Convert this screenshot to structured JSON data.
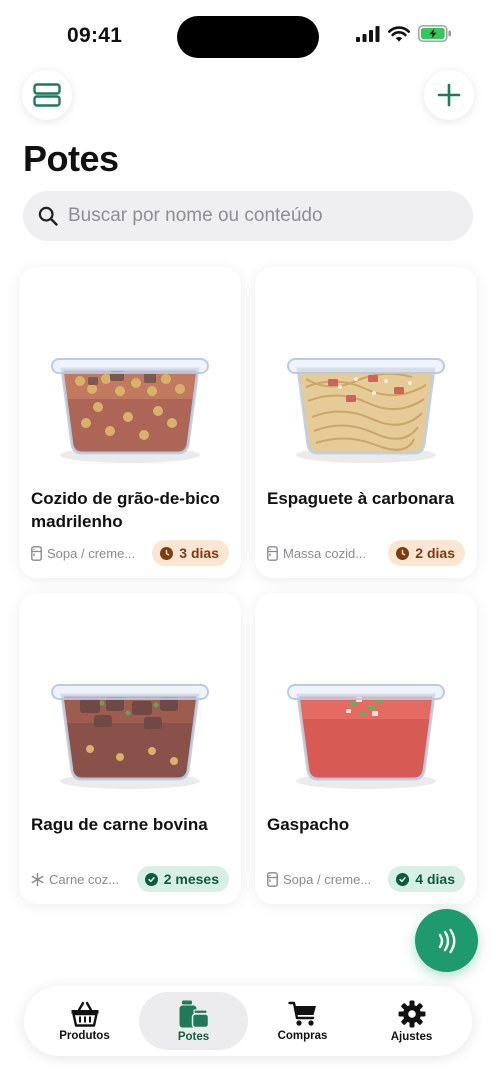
{
  "status_bar": {
    "time": "09:41"
  },
  "header": {
    "title": "Potes"
  },
  "search": {
    "placeholder": "Buscar por nome ou conteúdo"
  },
  "cards": [
    {
      "name": "Cozido de grão-de-bico madrilenho",
      "category": "Sopa / creme...",
      "category_icon": "fridge-icon",
      "badge": "3 dias",
      "badge_status": "warn"
    },
    {
      "name": "Espaguete à carbonara",
      "category": "Massa cozid...",
      "category_icon": "fridge-icon",
      "badge": "2 dias",
      "badge_status": "warn"
    },
    {
      "name": "Ragu de carne bovina",
      "category": "Carne coz...",
      "category_icon": "snowflake-icon",
      "badge": "2 meses",
      "badge_status": "ok"
    },
    {
      "name": "Gaspacho",
      "category": "Sopa / creme...",
      "category_icon": "fridge-icon",
      "badge": "4 dias",
      "badge_status": "ok"
    }
  ],
  "tabs": [
    {
      "label": "Produtos",
      "icon": "basket-icon"
    },
    {
      "label": "Potes",
      "icon": "jars-icon",
      "active": true
    },
    {
      "label": "Compras",
      "icon": "cart-icon"
    },
    {
      "label": "Ajustes",
      "icon": "gear-icon"
    }
  ],
  "colors": {
    "accent": "#1f9a6f",
    "warn_badge_bg": "#fbe6d3",
    "ok_badge_bg": "#d7efe5"
  }
}
